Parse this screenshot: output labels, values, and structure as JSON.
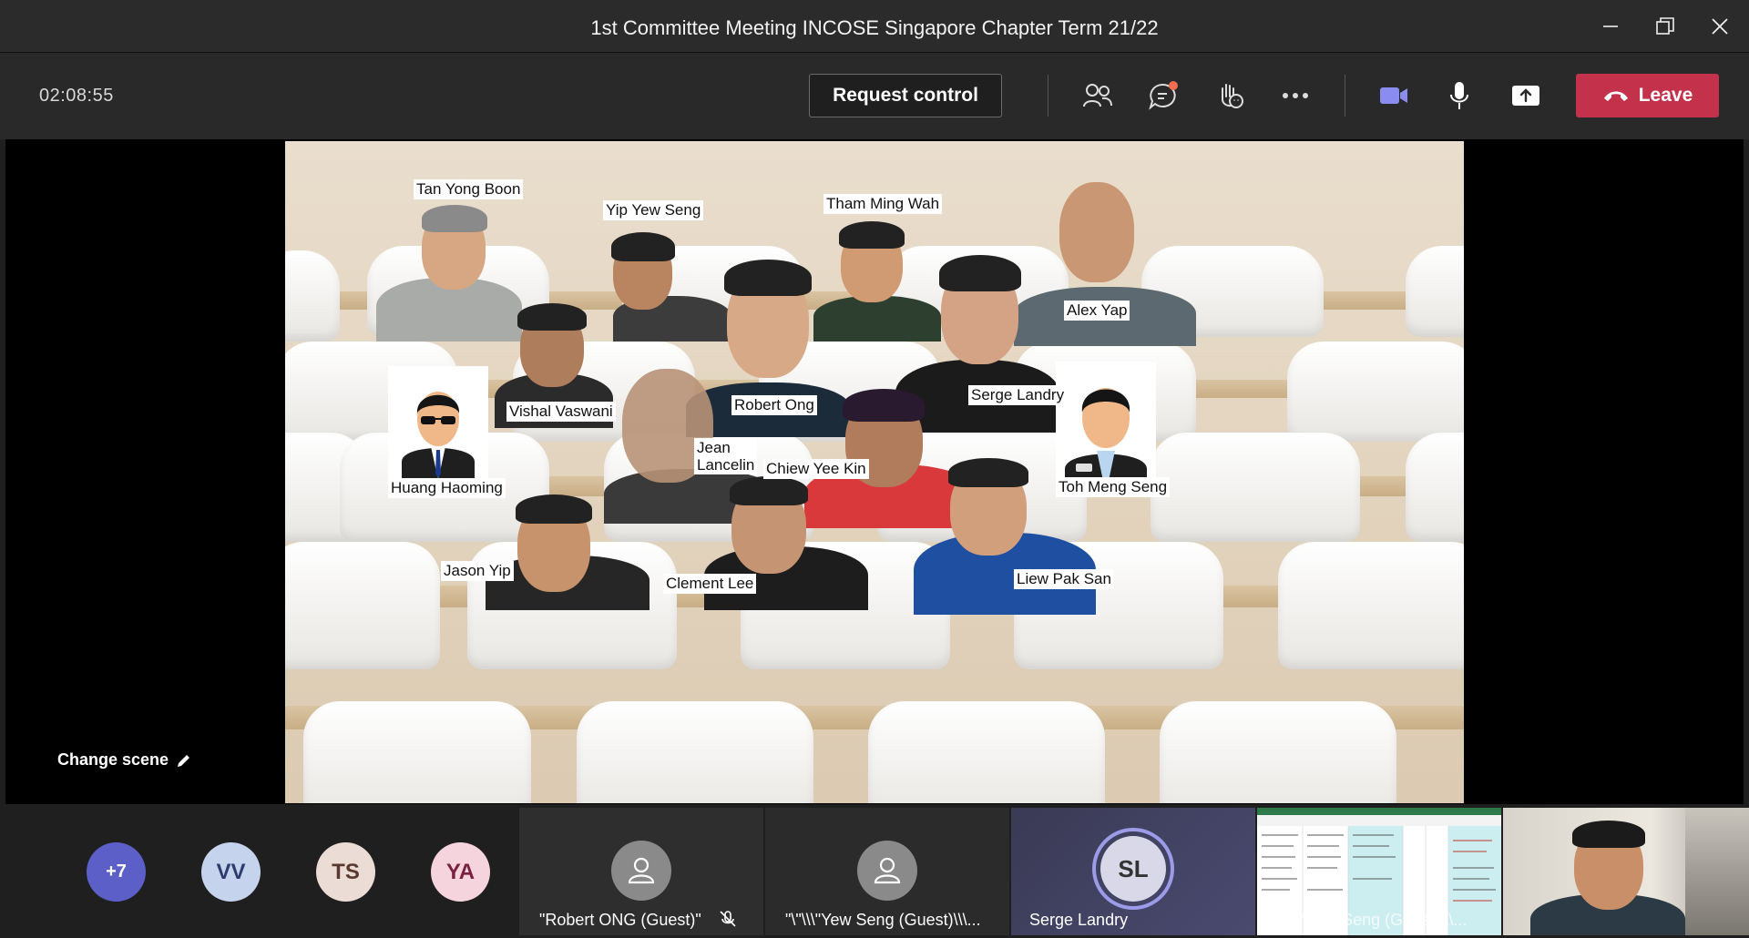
{
  "window": {
    "title": "1st Committee Meeting INCOSE Singapore Chapter Term 21/22",
    "minimize_icon": "minimize-icon",
    "maximize_icon": "restore-icon",
    "close_icon": "close-icon"
  },
  "toolbar": {
    "timer": "02:08:55",
    "request_control_label": "Request control",
    "leave_label": "Leave",
    "icons": [
      "participants-icon",
      "chat-icon",
      "raise-hand-icon",
      "more-icon",
      "camera-icon",
      "microphone-icon",
      "share-icon"
    ],
    "leave_color": "#c4314b",
    "chat_badge_color": "#f26d4f"
  },
  "stage": {
    "change_scene_label": "Change scene",
    "participants": [
      "Tan Yong Boon",
      "Yip Yew Seng",
      "Tham Ming Wah",
      "Alex Yap",
      "Vishal Vaswani",
      "Robert Ong",
      "Serge Landry",
      "Huang Haoming",
      "Jean\nLancelin",
      "Chiew Yee Kin",
      "Toh Meng Seng",
      "Jason Yip",
      "Clement Lee",
      "Liew Pak San"
    ]
  },
  "strip": {
    "overflow_count": "+7",
    "initials": [
      {
        "text": "VV",
        "bg": "#c5d3ec",
        "fg": "#2e3c6e"
      },
      {
        "text": "TS",
        "bg": "#ecdcd6",
        "fg": "#5a3a30"
      },
      {
        "text": "YA",
        "bg": "#f6d4de",
        "fg": "#7a2040"
      }
    ],
    "overflow_bg": "#5b5fc7",
    "tiles": [
      {
        "name": "\"Robert ONG (Guest)\"",
        "muted": true
      },
      {
        "name": "\"\\\"\\\\\\\"Yew Seng (Guest)\\\\\\..."
      },
      {
        "name": "Serge Landry",
        "initials": "SL"
      }
    ],
    "screen_share_label": "\\\"\\\\\\\"Yew Seng (Guest)\\\\\\..."
  }
}
